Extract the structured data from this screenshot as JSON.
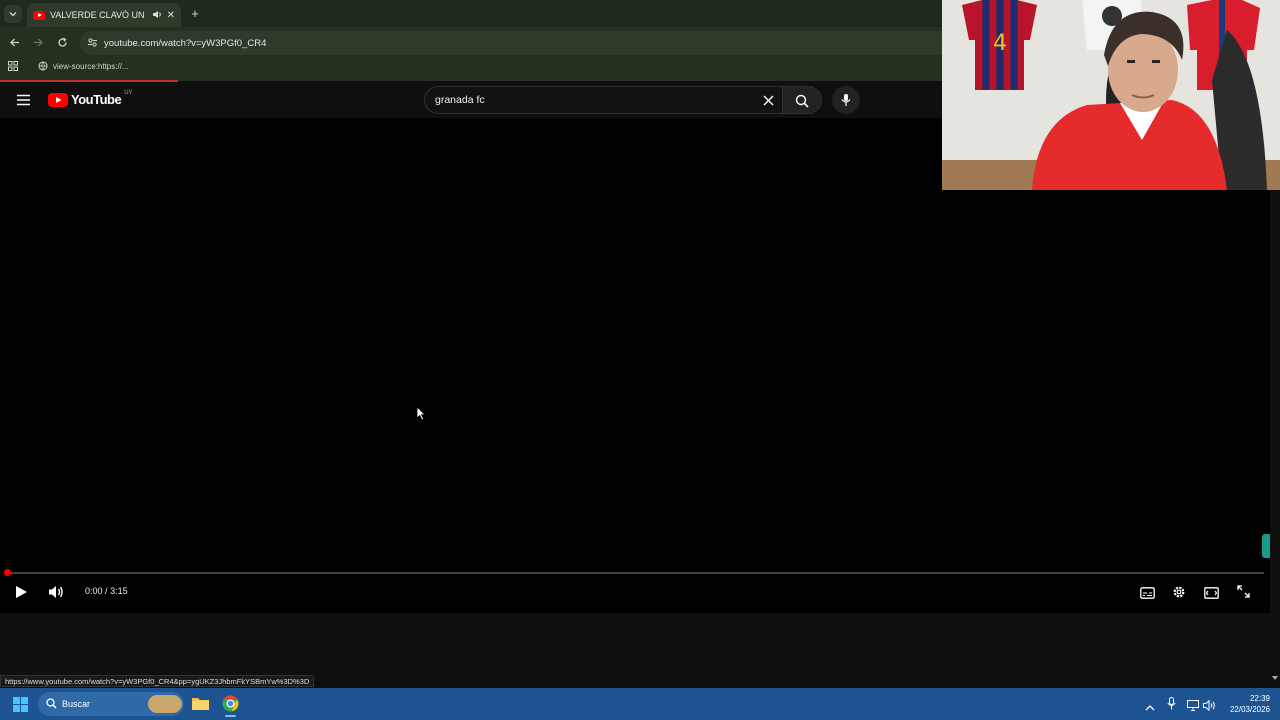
{
  "browser": {
    "tab_title": "VALVERDE CLAVÓ UN GOL A",
    "url": "youtube.com/watch?v=yW3PGf0_CR4",
    "bookmark": "view-source:https://...",
    "status_url": "https://www.youtube.com/watch?v=yW3PGf0_CR4&pp=ygUKZ3JhbmFkYSBmYw%3D%3D"
  },
  "youtube": {
    "logo_text": "YouTube",
    "region": "UY",
    "search_query": "granada fc"
  },
  "player": {
    "time_current": "0:00",
    "time_separator": "/",
    "time_total": "3:15",
    "progress": 0.0
  },
  "taskbar": {
    "search_label": "Buscar",
    "time": "22:39",
    "date": "22/03/2026"
  },
  "colors": {
    "brand_red": "#ff0000",
    "browser_theme": "#243020",
    "taskbar": "#1d5391"
  }
}
